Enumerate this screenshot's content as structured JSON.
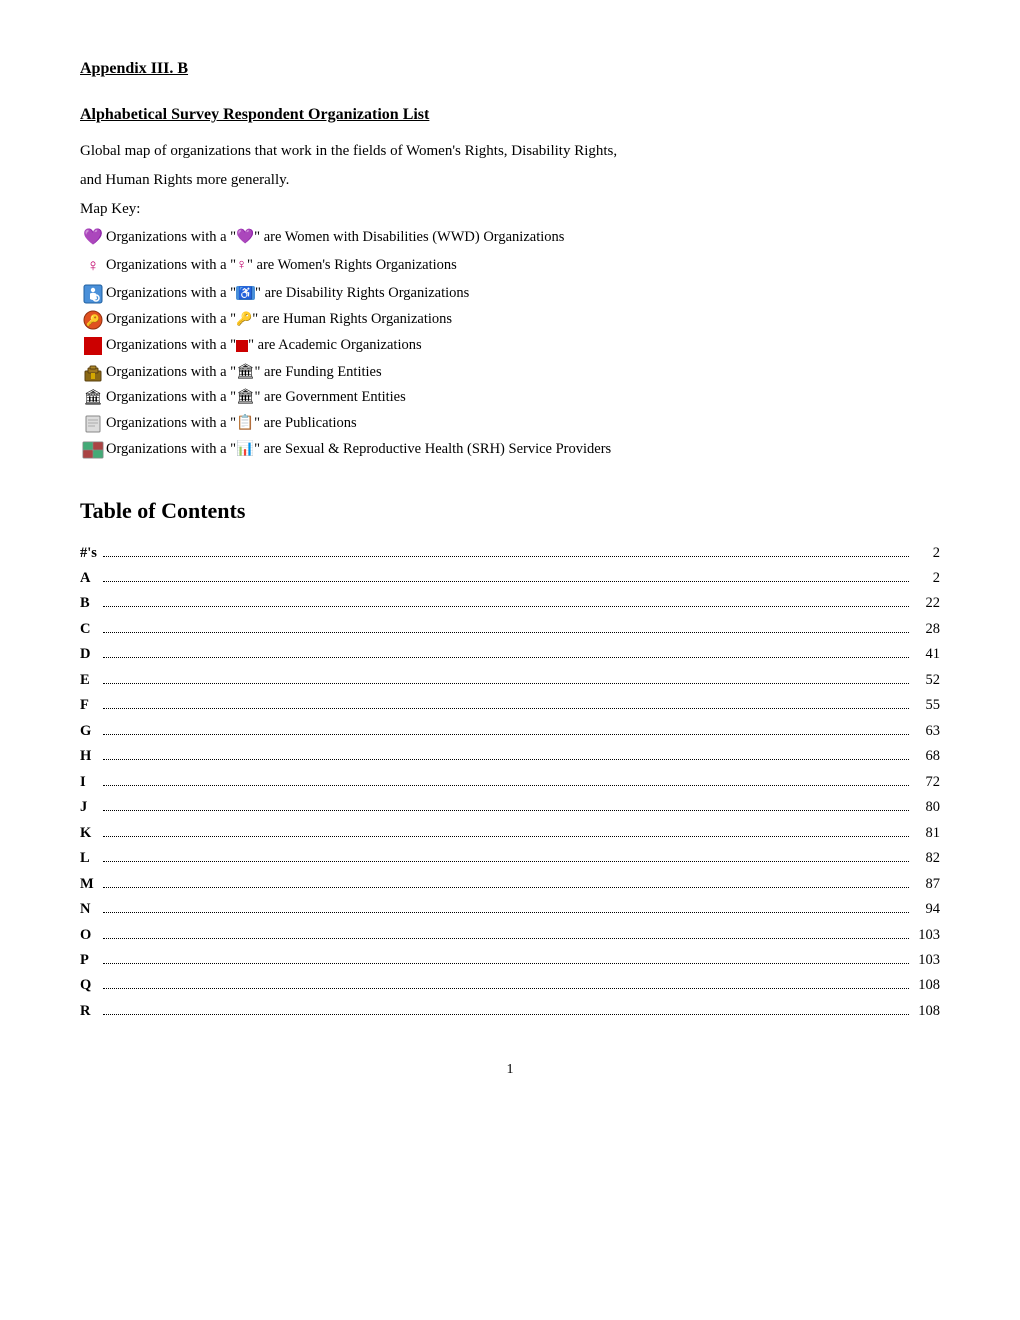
{
  "appendix": {
    "title": "Appendix III. B"
  },
  "header": {
    "title": "Alphabetical Survey Respondent Organization List"
  },
  "intro": {
    "line1": "Global map of organizations that work in the fields of Women's Rights, Disability Rights,",
    "line2": "and Human Rights more generally.",
    "mapkey": "Map Key:"
  },
  "mapkey_items": [
    {
      "icon": "💜",
      "icon_type": "emoji",
      "text": " Organizations with a \"💜\" are Women with Disabilities (WWD) Organizations"
    },
    {
      "icon": "♀",
      "icon_type": "text",
      "text": " Organizations with a \"♀\" are Women's Rights Organizations"
    },
    {
      "icon": "♿",
      "icon_type": "emoji",
      "text": " Organizations with a \"♿\" are Disability Rights Organizations"
    },
    {
      "icon": "🔑",
      "icon_type": "emoji",
      "text": " Organizations with a \"🔑\" are Human Rights Organizations"
    },
    {
      "icon": "🟥",
      "icon_type": "emoji",
      "text": " Organizations with a \"🟥\" are Academic Organizations"
    },
    {
      "icon": "🏛",
      "icon_type": "emoji",
      "text": " Organizations with a \"🏛\" are Funding Entities"
    },
    {
      "icon": "🏛",
      "icon_type": "emoji",
      "text": " Organizations with a \"🏛\" are Government Entities"
    },
    {
      "icon": "📋",
      "icon_type": "emoji",
      "text": " Organizations with a \"📋\" are Publications"
    },
    {
      "icon": "📊",
      "icon_type": "emoji",
      "text": "Organizations with a \"📊\" are Sexual & Reproductive Health (SRH) Service Providers"
    }
  ],
  "toc": {
    "heading": "Table of Contents",
    "items": [
      {
        "letter": "#'s",
        "page": "2"
      },
      {
        "letter": "A",
        "page": "2"
      },
      {
        "letter": "B",
        "page": "22"
      },
      {
        "letter": "C",
        "page": "28"
      },
      {
        "letter": "D",
        "page": "41"
      },
      {
        "letter": "E",
        "page": "52"
      },
      {
        "letter": "F",
        "page": "55"
      },
      {
        "letter": "G",
        "page": "63"
      },
      {
        "letter": "H",
        "page": "68"
      },
      {
        "letter": "I",
        "page": "72"
      },
      {
        "letter": "J",
        "page": "80"
      },
      {
        "letter": "K",
        "page": "81"
      },
      {
        "letter": "L",
        "page": "82"
      },
      {
        "letter": "M",
        "page": "87"
      },
      {
        "letter": "N",
        "page": "94"
      },
      {
        "letter": "O",
        "page": "103"
      },
      {
        "letter": "P",
        "page": "103"
      },
      {
        "letter": "Q",
        "page": "108"
      },
      {
        "letter": "R",
        "page": "108"
      }
    ]
  },
  "footer": {
    "page_number": "1"
  }
}
